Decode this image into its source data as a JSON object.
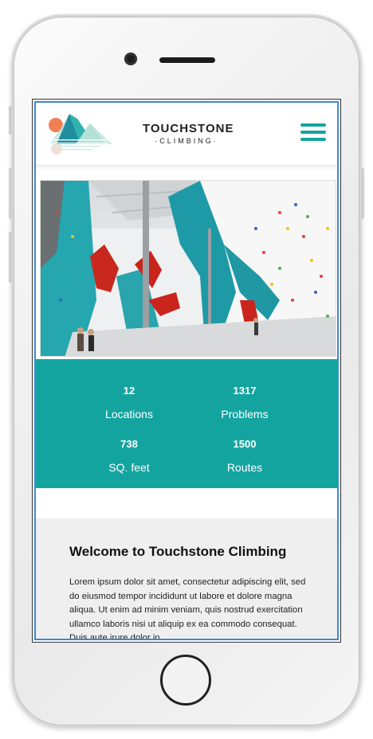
{
  "brand": {
    "name": "TOUCHSTONE",
    "subtitle": "·CLIMBING·"
  },
  "colors": {
    "accent": "#14a4a0",
    "screen_border": "#3a8ad8"
  },
  "icons": {
    "menu": "hamburger-menu-icon",
    "logo": "mountain-logo-icon"
  },
  "hero": {
    "image": "climbing-gym-interior-photo"
  },
  "stats": [
    {
      "value": "12",
      "label": "Locations"
    },
    {
      "value": "1317",
      "label": "Problems"
    },
    {
      "value": "738",
      "label": "SQ. feet"
    },
    {
      "value": "1500",
      "label": "Routes"
    }
  ],
  "welcome": {
    "title": "Welcome to Touchstone Climbing",
    "body": "Lorem ipsum dolor sit amet, consectetur adipiscing elit, sed do eiusmod tempor incididunt ut labore et dolore magna aliqua. Ut enim ad minim veniam, quis nostrud exercitation ullamco laboris nisi ut aliquip ex ea commodo consequat. Duis aute irure dolor in"
  }
}
